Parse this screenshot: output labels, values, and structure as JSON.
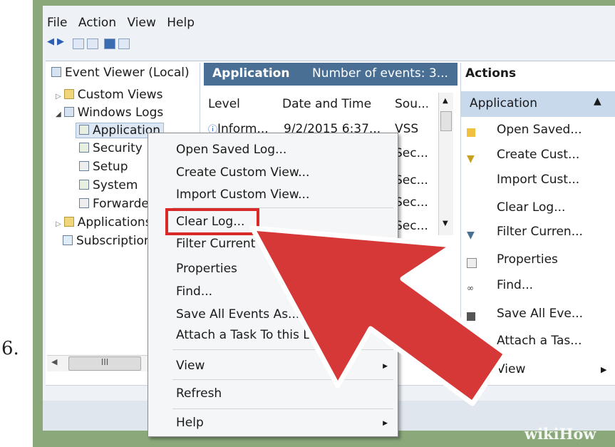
{
  "step_number": "6.",
  "menubar": {
    "items": [
      "File",
      "Action",
      "View",
      "Help"
    ]
  },
  "tree": {
    "root": "Event Viewer (Local)",
    "items": [
      "Custom Views",
      "Windows Logs",
      "Application",
      "Security",
      "Setup",
      "System",
      "Forwarded",
      "Applications",
      "Subscriptions"
    ]
  },
  "center": {
    "title": "Application",
    "events_label": "Number of events: 3...",
    "columns": [
      "Level",
      "Date and Time",
      "Sou..."
    ],
    "rows": [
      {
        "level": "Inform...",
        "date": "9/2/2015 6:37...",
        "source": "VSS"
      },
      {
        "level": "",
        "date": "",
        "source": "Sec..."
      },
      {
        "level": "",
        "date": "",
        "source": "Sec..."
      },
      {
        "level": "",
        "date": "",
        "source": "Sec..."
      },
      {
        "level": "",
        "date": "",
        "source": "Sec..."
      }
    ]
  },
  "actions": {
    "title": "Actions",
    "section": "Application",
    "items": [
      "Open Saved...",
      "Create Cust...",
      "Import Cust...",
      "Clear Log...",
      "Filter Curren...",
      "Properties",
      "Find...",
      "Save All Eve...",
      "Attach a Tas...",
      "View"
    ]
  },
  "context_menu": {
    "items": [
      "Open Saved Log...",
      "Create Custom View...",
      "Import Custom View...",
      "Clear Log...",
      "Filter Current",
      "Properties",
      "Find...",
      "Save All Events As...",
      "Attach a Task To this Log...",
      "View",
      "Refresh",
      "Help"
    ],
    "highlighted": "Clear Log..."
  },
  "hscroll_label": "III",
  "watermark": "wikiHow",
  "colors": {
    "frame": "#8aa87a",
    "header": "#4a6f95",
    "highlight": "#d92a2a",
    "arrow": "#d63838",
    "actions_sub": "#c8d9ec"
  }
}
